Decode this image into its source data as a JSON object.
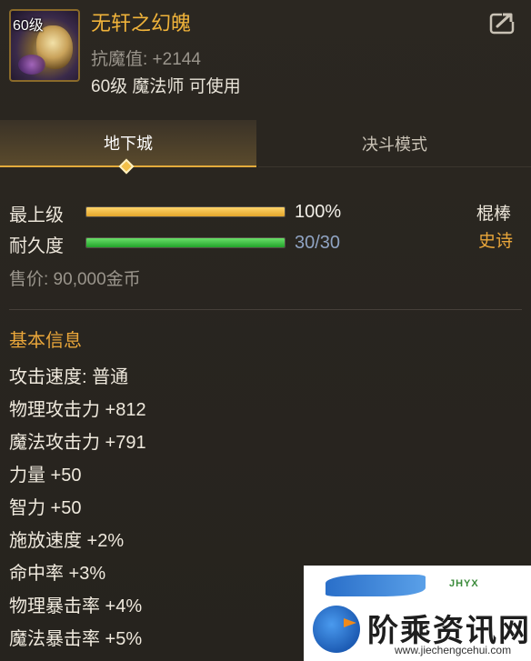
{
  "item": {
    "level_tag": "60级",
    "name": "无轩之幻魄",
    "stat_line": "抗魔值: +2144",
    "requirement": "60级 魔法师 可使用"
  },
  "tabs": [
    {
      "label": "地下城",
      "active": true
    },
    {
      "label": "决斗模式",
      "active": false
    }
  ],
  "status": {
    "level_label": "最上级",
    "level_value": "100%",
    "level_fraction": 1.0,
    "durability_label": "耐久度",
    "durability_value": "30/30",
    "durability_fraction": 1.0,
    "weapon_type": "棍棒",
    "rarity": "史诗",
    "price": "售价: 90,000金币"
  },
  "basic_info": {
    "title": "基本信息",
    "attributes": [
      "攻击速度: 普通",
      "物理攻击力 +812",
      "魔法攻击力 +791",
      "力量 +50",
      "智力 +50",
      "施放速度 +2%",
      "命中率 +3%",
      "物理暴击率 +4%",
      "魔法暴击率 +5%"
    ]
  },
  "watermark": {
    "tag": "JHYX",
    "title": "阶乘资讯网",
    "url": "www.jiechengcehui.com"
  },
  "colors": {
    "item_name": "#f0b33a",
    "rarity": "#e9a63a",
    "level_bar": "#e3a52a",
    "durability_bar": "#22a22a",
    "tab_accent": "#e3ab3c"
  }
}
